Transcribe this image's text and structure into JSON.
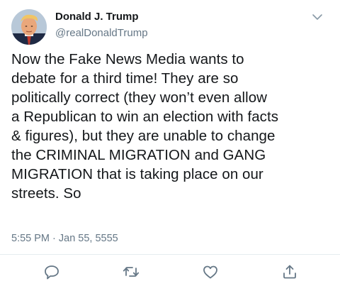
{
  "tweet": {
    "author": {
      "display_name": "Donald J. Trump",
      "handle": "@realDonaldTrump",
      "avatar_icon": "profile-photo"
    },
    "text_lines": [
      "Now the Fake News Media wants to",
      "debate for a third time! They are so",
      "politically correct (they won’t even allow",
      "a Republican to win an election with facts",
      "& figures), but they are unable to change",
      "the CRIMINAL MIGRATION and GANG",
      "MIGRATION that is taking place on our",
      "streets. So"
    ],
    "timestamp": "5:55 PM · Jan 55, 5555",
    "menu_icon": "chevron-down-icon",
    "actions": [
      {
        "name": "reply",
        "icon": "speech-bubble-icon"
      },
      {
        "name": "retweet",
        "icon": "retweet-arrows-icon"
      },
      {
        "name": "like",
        "icon": "heart-icon"
      },
      {
        "name": "share",
        "icon": "share-upload-icon"
      }
    ]
  },
  "colors": {
    "text_primary": "#14171a",
    "text_secondary": "#657786",
    "icon_gray": "#657786",
    "divider": "#e6ecf0"
  }
}
